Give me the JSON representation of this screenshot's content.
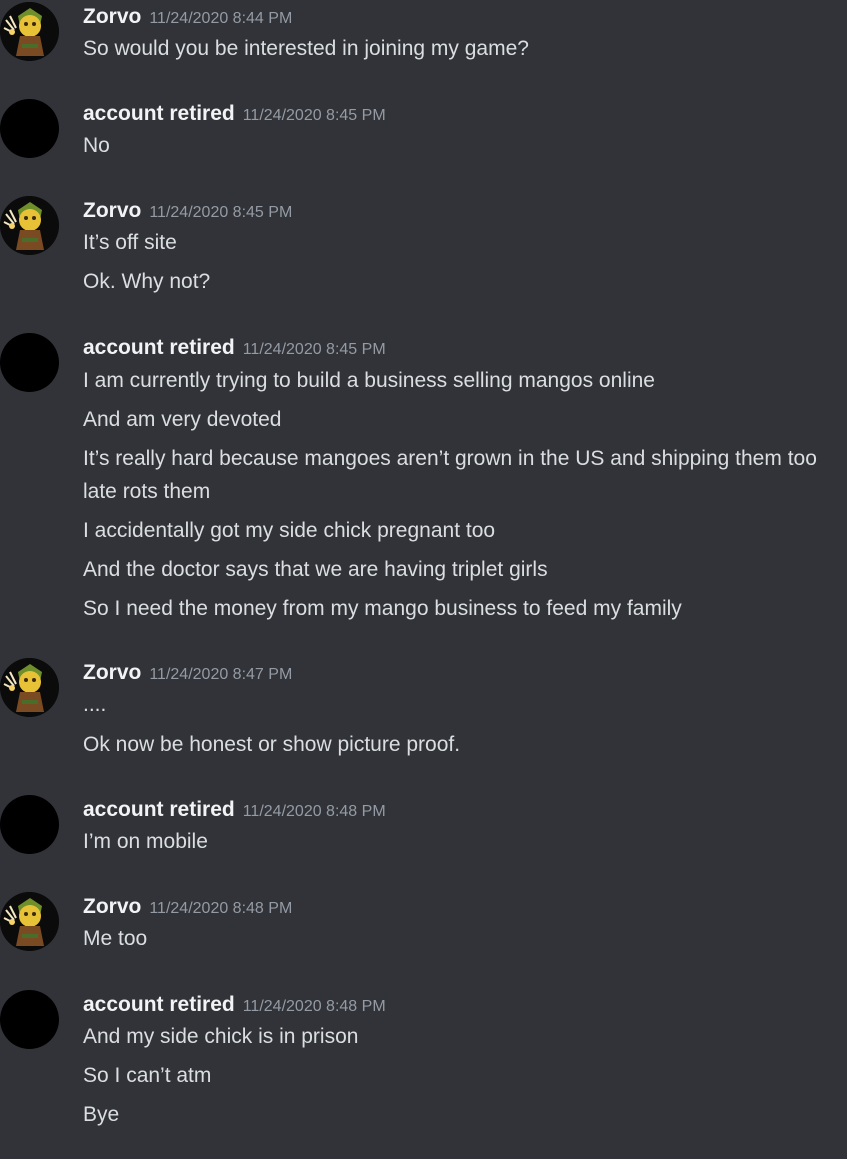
{
  "messages": [
    {
      "user": "Zorvo",
      "timestamp": "11/24/2020 8:44 PM",
      "avatar": "zorvo-avatar-icon",
      "lines": [
        "So would you be interested in joining my game?"
      ]
    },
    {
      "user": "account retired",
      "timestamp": "11/24/2020 8:45 PM",
      "avatar": "black-avatar",
      "lines": [
        "No"
      ]
    },
    {
      "user": "Zorvo",
      "timestamp": "11/24/2020 8:45 PM",
      "avatar": "zorvo-avatar-icon",
      "lines": [
        "It’s off site",
        "Ok. Why not?"
      ]
    },
    {
      "user": "account retired",
      "timestamp": "11/24/2020 8:45 PM",
      "avatar": "black-avatar",
      "lines": [
        "I am currently trying to build a business selling mangos online",
        "And am very devoted",
        "It’s really hard because mangoes  aren’t grown in the US and shipping them too late rots them",
        "I accidentally got my side chick pregnant too",
        "And the doctor says that we are having triplet girls",
        "So I need the money from my mango business to feed my family"
      ]
    },
    {
      "user": "Zorvo",
      "timestamp": "11/24/2020 8:47 PM",
      "avatar": "zorvo-avatar-icon",
      "lines": [
        "....",
        "Ok now be honest or show picture proof."
      ]
    },
    {
      "user": "account retired",
      "timestamp": "11/24/2020 8:48 PM",
      "avatar": "black-avatar",
      "lines": [
        "I’m on mobile"
      ]
    },
    {
      "user": "Zorvo",
      "timestamp": "11/24/2020 8:48 PM",
      "avatar": "zorvo-avatar-icon",
      "lines": [
        "Me too"
      ]
    },
    {
      "user": "account retired",
      "timestamp": "11/24/2020 8:48 PM",
      "avatar": "black-avatar",
      "lines": [
        "And my side chick is in prison",
        "So I can’t atm",
        "Bye"
      ]
    }
  ],
  "colors": {
    "background": "#313338",
    "username": "#f2f3f5",
    "timestamp": "#949ba4",
    "text": "#dbdee1"
  }
}
